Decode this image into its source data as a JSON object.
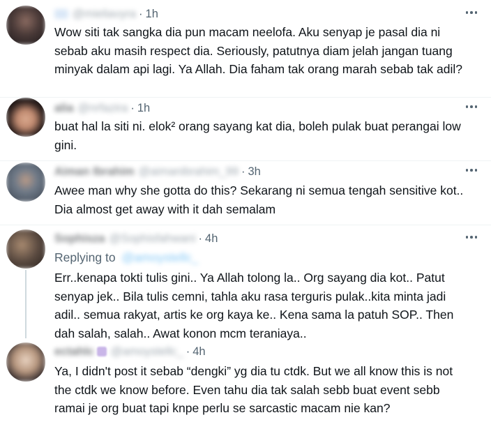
{
  "tweets": [
    {
      "name": "",
      "handle": "@mieliavyra",
      "time": "1h",
      "text": "Wow siti tak sangka dia pun macam neelofa. Aku senyap je pasal dia ni sebab aku masih respect dia. Seriously, patutnya diam jelah jangan tuang minyak dalam api lagi. Ya Allah. Dia faham tak orang marah sebab tak adil?"
    },
    {
      "name": "alia",
      "handle": "@nrfazira",
      "time": "1h",
      "text": "buat hal la siti ni. elok² orang sayang kat dia, boleh pulak buat perangai low gini."
    },
    {
      "name": "Aiman Ibrahim",
      "handle": "@aimanibrahim_99",
      "time": "3h",
      "text": "Awee man why she gotta do this? Sekarang ni semua tengah sensitive kot.. Dia almost get away with it dah semalam"
    },
    {
      "name": "Sophisza",
      "handle": "@Sophisfahwani",
      "time": "4h",
      "replying_label": "Replying to",
      "replying_to": "@amoystellc_",
      "text": "Err..kenapa tokti tulis gini.. Ya Allah tolong la.. Org sayang dia kot.. Patut senyap jek.. Bila tulis cemni, tahla aku rasa terguris pulak..kita minta jadi adil.. semua rakyat, artis ke org kaya ke.. Kena sama la patuh SOP.. Then dah salah, salah.. Awat konon mcm teraniaya.."
    },
    {
      "name": "ectahlc",
      "handle": "@amoystellc_",
      "time": "4h",
      "text": "Ya, I didn't post it sebab “dengki” yg dia tu ctdk. But we all know this is not the ctdk we know before. Even tahu dia tak salah sebb buat event sebb ramai je org buat tapi knpe perlu se sarcastic macam nie kan?"
    }
  ],
  "separator": "·",
  "icons": {
    "more": "more-horizontal-icon",
    "verified": "verified-badge-icon"
  },
  "colors": {
    "text": "#0f1419",
    "secondary": "#536471",
    "link": "#1d9bf0",
    "divider": "#eff3f4"
  }
}
